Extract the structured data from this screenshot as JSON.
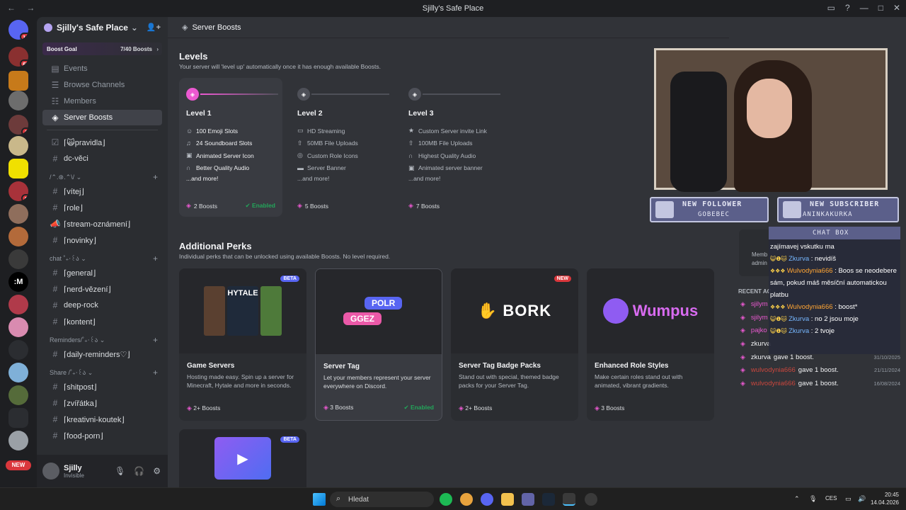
{
  "window": {
    "title": "Sjilly's Safe Place",
    "nav": "← →"
  },
  "servers": {
    "badges": [
      "16",
      "67",
      "1",
      "9"
    ],
    "new_label": "NEW"
  },
  "sidebar": {
    "server_name": "Sjilly's Safe Place",
    "boost_goal": {
      "label": "Boost Goal",
      "count": "7/40 Boosts"
    },
    "nav_items": [
      {
        "label": "Events"
      },
      {
        "label": "Browse Channels"
      },
      {
        "label": "Members"
      },
      {
        "label": "Server Boosts"
      }
    ],
    "top_channels": [
      "⌈🙀pravidla⌋",
      "dc-věci"
    ],
    "categories": [
      {
        "name": "/⌃.⊛.⌃\\/ ⌄",
        "channels": [
          "⌈vítej⌋",
          "⌈role⌋",
          "⌈stream-oznámení⌋",
          "⌈novinky⌋"
        ]
      },
      {
        "name": "chat ˚₊‧꒰ა ⌄",
        "channels": [
          "⌈general⌋",
          "⌈nerd-vězení⌋",
          "deep-rock",
          "⌈kontent⌋"
        ]
      },
      {
        "name": "Reminders/˚₊‧꒰ა ⌄",
        "channels": [
          "⌈daily-reminders♡⌋"
        ]
      },
      {
        "name": "Share /˚₊‧꒰ა ⌄",
        "channels": [
          "⌈shitpost⌋",
          "⌈zvířátka⌋",
          "⌈kreativni-koutek⌋",
          "⌈food-porn⌋"
        ]
      }
    ],
    "user": {
      "name": "Sjilly",
      "status": "Invisible"
    }
  },
  "header": {
    "title": "Server Boosts"
  },
  "levels": {
    "title": "Levels",
    "subtitle": "Your server will 'level up' automatically once it has enough available Boosts.",
    "items": [
      {
        "name": "Level 1",
        "perks": [
          "100 Emoji Slots",
          "24 Soundboard Slots",
          "Animated Server Icon",
          "Better Quality Audio"
        ],
        "more": "...and more!",
        "boosts": "2 Boosts",
        "status": "Enabled"
      },
      {
        "name": "Level 2",
        "perks": [
          "HD Streaming",
          "50MB File Uploads",
          "Custom Role Icons",
          "Server Banner"
        ],
        "more": "...and more!",
        "boosts": "5 Boosts"
      },
      {
        "name": "Level 3",
        "perks": [
          "Custom Server invite Link",
          "100MB File Uploads",
          "Highest Quality Audio",
          "Animated server banner"
        ],
        "more": "...and more!",
        "boosts": "7 Boosts"
      }
    ]
  },
  "perks": {
    "title": "Additional Perks",
    "subtitle": "Individual perks that can be unlocked using available Boosts. No level required.",
    "items": [
      {
        "tag": "BETA",
        "art": "HYTALE",
        "title": "Game Servers",
        "desc": "Hosting made easy. Spin up a server for Minecraft, Hytale and more in seconds.",
        "boosts": "2+ Boosts"
      },
      {
        "tag": "",
        "art1": "POLR",
        "art2": "GGEZ",
        "title": "Server Tag",
        "desc": "Let your members represent your server everywhere on Discord.",
        "boosts": "3 Boosts",
        "status": "Enabled"
      },
      {
        "tag": "NEW",
        "art": "BORK",
        "title": "Server Tag Badge Packs",
        "desc": "Stand out with special, themed badge packs for your Server Tag.",
        "boosts": "2+ Boosts"
      },
      {
        "tag": "",
        "art": "Wumpus",
        "title": "Enhanced Role Styles",
        "desc": "Make certain roles stand out with animated, vibrant gradients.",
        "boosts": "3 Boosts"
      },
      {
        "tag": "BETA"
      }
    ]
  },
  "stream_overlay": {
    "follower_title": "NEW FOLLOWER",
    "follower_name": "GOBEBEC",
    "subscriber_title": "NEW SUBSCRIBER",
    "subscriber_name": "ANINKAKURKA",
    "chat_title": "CHAT BOX",
    "chat": [
      {
        "name": "",
        "text": "zajímavej vskutku ma"
      },
      {
        "name": "Zkurva",
        "text": ": nevidíš"
      },
      {
        "name": "Wulvodynia666",
        "text": ": Boos se neodebere sám, pokud máš měsíční automatickou platbu"
      },
      {
        "name": "Wulvodynia666",
        "text": ": boost*"
      },
      {
        "name": "Zkurva",
        "text": ": no 2 jsou moje"
      },
      {
        "name": "Zkurva",
        "text": ": 2 tvoje"
      }
    ]
  },
  "recent": {
    "members_label": "Memb",
    "admin_label": "admin",
    "title": "RECENT AC",
    "items": [
      {
        "name": "sjilym",
        "text": "",
        "date": ""
      },
      {
        "name": "sjilym",
        "text": "",
        "date": ""
      },
      {
        "name": "pajko",
        "text": "",
        "date": ""
      },
      {
        "name": "zkurva",
        "text": "",
        "date": ""
      },
      {
        "name": "zkurva",
        "text": "gave 1 boost.",
        "date": "31/10/2025"
      },
      {
        "name": "wulvodynia666",
        "text": "gave 1 boost.",
        "date": "21/11/2024"
      },
      {
        "name": "wulvodynia666",
        "text": "gave 1 boost.",
        "date": "16/08/2024"
      }
    ]
  },
  "taskbar": {
    "search": "Hledat",
    "lang": "CES",
    "time": "20:45",
    "date": "14.04.2026"
  }
}
